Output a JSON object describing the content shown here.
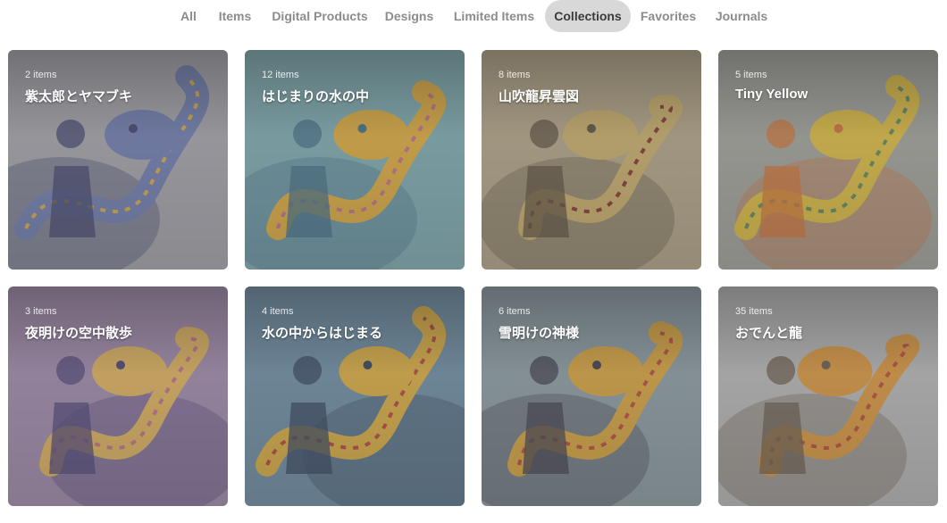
{
  "tabs": [
    {
      "label": "All",
      "active": false
    },
    {
      "label": "Items",
      "active": false
    },
    {
      "label": "Digital Products",
      "active": false
    },
    {
      "label": "Designs",
      "active": false
    },
    {
      "label": "Limited Items",
      "active": false
    },
    {
      "label": "Collections",
      "active": true
    },
    {
      "label": "Favorites",
      "active": false
    },
    {
      "label": "Journals",
      "active": false
    }
  ],
  "collections": [
    {
      "count": "2 items",
      "title": "紫太郎とヤマブキ",
      "palette": [
        "#a8a8b0",
        "#6f7fb8",
        "#e0b040",
        "#3b3f6e"
      ]
    },
    {
      "count": "12 items",
      "title": "はじまりの水の中",
      "palette": [
        "#7fb0b8",
        "#e6b13a",
        "#c9718a",
        "#3e6f8a"
      ]
    },
    {
      "count": "8 items",
      "title": "山吹龍昇雲図",
      "palette": [
        "#b9a98a",
        "#d2b46a",
        "#8c2f2a",
        "#5b4e3a"
      ]
    },
    {
      "count": "5 items",
      "title": "Tiny Yellow",
      "palette": [
        "#a7a7a0",
        "#e6c23c",
        "#5f8b5a",
        "#d9742e"
      ]
    },
    {
      "count": "3 items",
      "title": "夜明けの空中散歩",
      "palette": [
        "#a48bb0",
        "#e8b85a",
        "#c96f8a",
        "#4a3f78"
      ]
    },
    {
      "count": "4 items",
      "title": "水の中からはじまる",
      "palette": [
        "#6c8fa8",
        "#e2b23c",
        "#b9433a",
        "#2f3f5c"
      ]
    },
    {
      "count": "6 items",
      "title": "雪明けの神様",
      "palette": [
        "#8ea0a8",
        "#e0a83a",
        "#c0473a",
        "#3b3a48"
      ]
    },
    {
      "count": "35 items",
      "title": "おでんと龍",
      "palette": [
        "#bdbdbd",
        "#e39a3a",
        "#c04a30",
        "#6a5a4a"
      ]
    }
  ]
}
